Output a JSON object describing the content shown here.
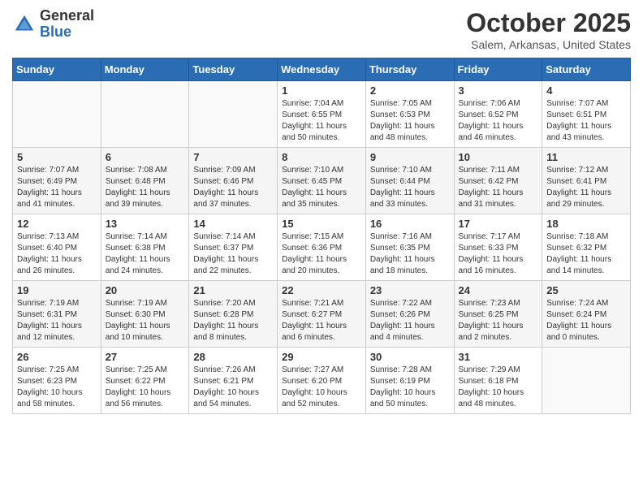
{
  "header": {
    "logo_general": "General",
    "logo_blue": "Blue",
    "month_title": "October 2025",
    "location": "Salem, Arkansas, United States"
  },
  "days_of_week": [
    "Sunday",
    "Monday",
    "Tuesday",
    "Wednesday",
    "Thursday",
    "Friday",
    "Saturday"
  ],
  "weeks": [
    [
      {
        "day": "",
        "sunrise": "",
        "sunset": "",
        "daylight": ""
      },
      {
        "day": "",
        "sunrise": "",
        "sunset": "",
        "daylight": ""
      },
      {
        "day": "",
        "sunrise": "",
        "sunset": "",
        "daylight": ""
      },
      {
        "day": "1",
        "sunrise": "Sunrise: 7:04 AM",
        "sunset": "Sunset: 6:55 PM",
        "daylight": "Daylight: 11 hours and 50 minutes."
      },
      {
        "day": "2",
        "sunrise": "Sunrise: 7:05 AM",
        "sunset": "Sunset: 6:53 PM",
        "daylight": "Daylight: 11 hours and 48 minutes."
      },
      {
        "day": "3",
        "sunrise": "Sunrise: 7:06 AM",
        "sunset": "Sunset: 6:52 PM",
        "daylight": "Daylight: 11 hours and 46 minutes."
      },
      {
        "day": "4",
        "sunrise": "Sunrise: 7:07 AM",
        "sunset": "Sunset: 6:51 PM",
        "daylight": "Daylight: 11 hours and 43 minutes."
      }
    ],
    [
      {
        "day": "5",
        "sunrise": "Sunrise: 7:07 AM",
        "sunset": "Sunset: 6:49 PM",
        "daylight": "Daylight: 11 hours and 41 minutes."
      },
      {
        "day": "6",
        "sunrise": "Sunrise: 7:08 AM",
        "sunset": "Sunset: 6:48 PM",
        "daylight": "Daylight: 11 hours and 39 minutes."
      },
      {
        "day": "7",
        "sunrise": "Sunrise: 7:09 AM",
        "sunset": "Sunset: 6:46 PM",
        "daylight": "Daylight: 11 hours and 37 minutes."
      },
      {
        "day": "8",
        "sunrise": "Sunrise: 7:10 AM",
        "sunset": "Sunset: 6:45 PM",
        "daylight": "Daylight: 11 hours and 35 minutes."
      },
      {
        "day": "9",
        "sunrise": "Sunrise: 7:10 AM",
        "sunset": "Sunset: 6:44 PM",
        "daylight": "Daylight: 11 hours and 33 minutes."
      },
      {
        "day": "10",
        "sunrise": "Sunrise: 7:11 AM",
        "sunset": "Sunset: 6:42 PM",
        "daylight": "Daylight: 11 hours and 31 minutes."
      },
      {
        "day": "11",
        "sunrise": "Sunrise: 7:12 AM",
        "sunset": "Sunset: 6:41 PM",
        "daylight": "Daylight: 11 hours and 29 minutes."
      }
    ],
    [
      {
        "day": "12",
        "sunrise": "Sunrise: 7:13 AM",
        "sunset": "Sunset: 6:40 PM",
        "daylight": "Daylight: 11 hours and 26 minutes."
      },
      {
        "day": "13",
        "sunrise": "Sunrise: 7:14 AM",
        "sunset": "Sunset: 6:38 PM",
        "daylight": "Daylight: 11 hours and 24 minutes."
      },
      {
        "day": "14",
        "sunrise": "Sunrise: 7:14 AM",
        "sunset": "Sunset: 6:37 PM",
        "daylight": "Daylight: 11 hours and 22 minutes."
      },
      {
        "day": "15",
        "sunrise": "Sunrise: 7:15 AM",
        "sunset": "Sunset: 6:36 PM",
        "daylight": "Daylight: 11 hours and 20 minutes."
      },
      {
        "day": "16",
        "sunrise": "Sunrise: 7:16 AM",
        "sunset": "Sunset: 6:35 PM",
        "daylight": "Daylight: 11 hours and 18 minutes."
      },
      {
        "day": "17",
        "sunrise": "Sunrise: 7:17 AM",
        "sunset": "Sunset: 6:33 PM",
        "daylight": "Daylight: 11 hours and 16 minutes."
      },
      {
        "day": "18",
        "sunrise": "Sunrise: 7:18 AM",
        "sunset": "Sunset: 6:32 PM",
        "daylight": "Daylight: 11 hours and 14 minutes."
      }
    ],
    [
      {
        "day": "19",
        "sunrise": "Sunrise: 7:19 AM",
        "sunset": "Sunset: 6:31 PM",
        "daylight": "Daylight: 11 hours and 12 minutes."
      },
      {
        "day": "20",
        "sunrise": "Sunrise: 7:19 AM",
        "sunset": "Sunset: 6:30 PM",
        "daylight": "Daylight: 11 hours and 10 minutes."
      },
      {
        "day": "21",
        "sunrise": "Sunrise: 7:20 AM",
        "sunset": "Sunset: 6:28 PM",
        "daylight": "Daylight: 11 hours and 8 minutes."
      },
      {
        "day": "22",
        "sunrise": "Sunrise: 7:21 AM",
        "sunset": "Sunset: 6:27 PM",
        "daylight": "Daylight: 11 hours and 6 minutes."
      },
      {
        "day": "23",
        "sunrise": "Sunrise: 7:22 AM",
        "sunset": "Sunset: 6:26 PM",
        "daylight": "Daylight: 11 hours and 4 minutes."
      },
      {
        "day": "24",
        "sunrise": "Sunrise: 7:23 AM",
        "sunset": "Sunset: 6:25 PM",
        "daylight": "Daylight: 11 hours and 2 minutes."
      },
      {
        "day": "25",
        "sunrise": "Sunrise: 7:24 AM",
        "sunset": "Sunset: 6:24 PM",
        "daylight": "Daylight: 11 hours and 0 minutes."
      }
    ],
    [
      {
        "day": "26",
        "sunrise": "Sunrise: 7:25 AM",
        "sunset": "Sunset: 6:23 PM",
        "daylight": "Daylight: 10 hours and 58 minutes."
      },
      {
        "day": "27",
        "sunrise": "Sunrise: 7:25 AM",
        "sunset": "Sunset: 6:22 PM",
        "daylight": "Daylight: 10 hours and 56 minutes."
      },
      {
        "day": "28",
        "sunrise": "Sunrise: 7:26 AM",
        "sunset": "Sunset: 6:21 PM",
        "daylight": "Daylight: 10 hours and 54 minutes."
      },
      {
        "day": "29",
        "sunrise": "Sunrise: 7:27 AM",
        "sunset": "Sunset: 6:20 PM",
        "daylight": "Daylight: 10 hours and 52 minutes."
      },
      {
        "day": "30",
        "sunrise": "Sunrise: 7:28 AM",
        "sunset": "Sunset: 6:19 PM",
        "daylight": "Daylight: 10 hours and 50 minutes."
      },
      {
        "day": "31",
        "sunrise": "Sunrise: 7:29 AM",
        "sunset": "Sunset: 6:18 PM",
        "daylight": "Daylight: 10 hours and 48 minutes."
      },
      {
        "day": "",
        "sunrise": "",
        "sunset": "",
        "daylight": ""
      }
    ]
  ]
}
